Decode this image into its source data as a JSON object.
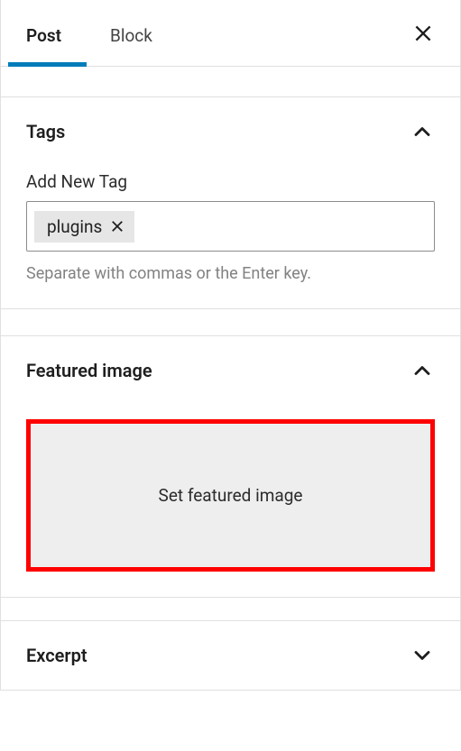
{
  "tabs": {
    "post": "Post",
    "block": "Block"
  },
  "panels": {
    "tags": {
      "title": "Tags",
      "add_label": "Add New Tag",
      "help": "Separate with commas or the Enter key.",
      "chips": [
        "plugins"
      ]
    },
    "featured_image": {
      "title": "Featured image",
      "button": "Set featured image"
    },
    "excerpt": {
      "title": "Excerpt"
    }
  }
}
